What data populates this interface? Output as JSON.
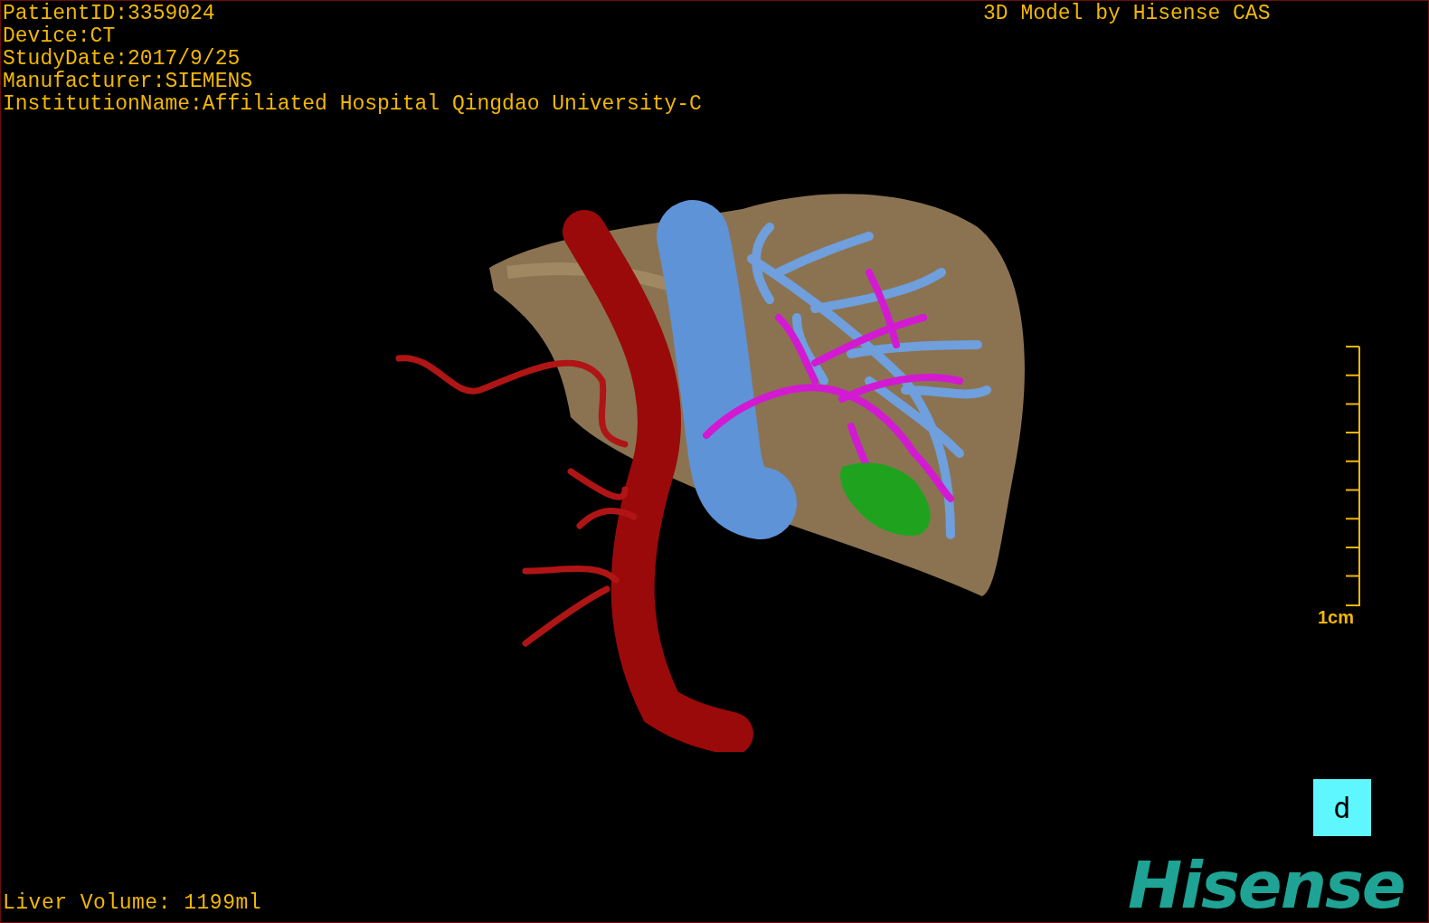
{
  "patient_info": [
    "PatientID:3359024",
    "Device:CT",
    "StudyDate:2017/9/25",
    "Manufacturer:SIEMENS",
    "InstitutionName:Affiliated Hospital Qingdao University-C"
  ],
  "model_credit": "3D Model by Hisense CAS",
  "scale_bar": {
    "label": "1cm"
  },
  "view_button": {
    "label": "d"
  },
  "liver_volume": "Liver Volume: 1199ml",
  "logo": "Hisense"
}
